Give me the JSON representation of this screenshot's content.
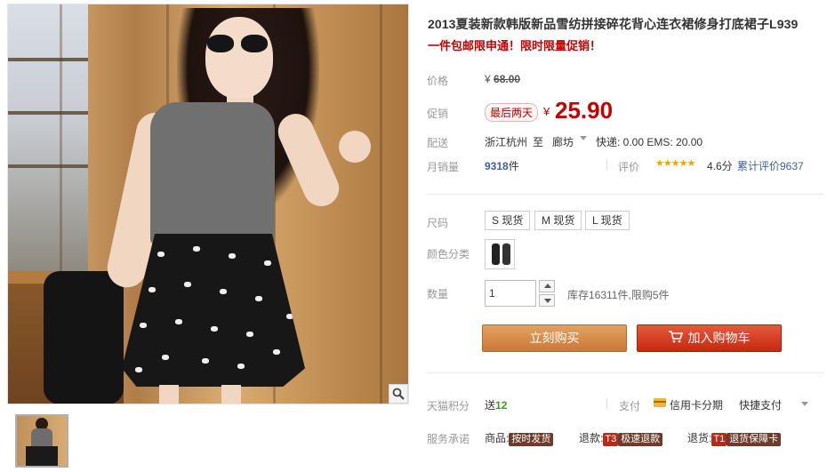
{
  "product": {
    "title": "2013夏装新款韩版新品雪纺拼接碎花背心连衣裙修身打底裙子L939",
    "subtitle": "一件包邮限申通！限时限量促销！"
  },
  "price": {
    "label": "价格",
    "currency": "¥",
    "original": "68.00",
    "promo_label": "促销",
    "promo_tag": "最后两天",
    "promo_price": "25.90"
  },
  "shipping": {
    "label": "配送",
    "from": "浙江杭州",
    "to_word": "至",
    "to": "廊坊",
    "fees": "快递: 0.00 EMS: 20.00"
  },
  "sales": {
    "label": "月销量",
    "count": "9318",
    "unit": "件",
    "rating_label": "评价",
    "stars": "★★★★★",
    "score": "4.6分",
    "total_reviews": "累计评价9637"
  },
  "options": {
    "size_label": "尺码",
    "sizes": [
      "S 现货",
      "M 现货",
      "L 现货"
    ],
    "color_label": "颜色分类",
    "qty_label": "数量",
    "qty_value": "1",
    "stock_text": "库存16311件,限购5件"
  },
  "actions": {
    "buy_now": "立刻购买",
    "add_cart": "加入购物车"
  },
  "bottom": {
    "points_label": "天猫积分",
    "points_prefix": "送",
    "points_value": "12",
    "pay_label": "支付",
    "installment": "信用卡分期",
    "quick_pay": "快捷支付",
    "service_label": "服务承诺",
    "goods_label": "商品:",
    "goods_badge": "按时发货",
    "refund_label": "退款:",
    "refund_code": "T3",
    "refund_badge": "极速退款",
    "return_label": "退货:",
    "return_code": "T1",
    "return_badge": "退货保障卡"
  },
  "colors": {
    "accent_red": "#c40000",
    "buy_orange": "#d38842",
    "cart_red": "#d3391f",
    "link_blue": "#3c5fa8",
    "star_orange": "#f0a20a"
  },
  "icons": [
    "zoom-icon",
    "cart-icon",
    "credit-card-icon",
    "chevron-down-icon"
  ]
}
